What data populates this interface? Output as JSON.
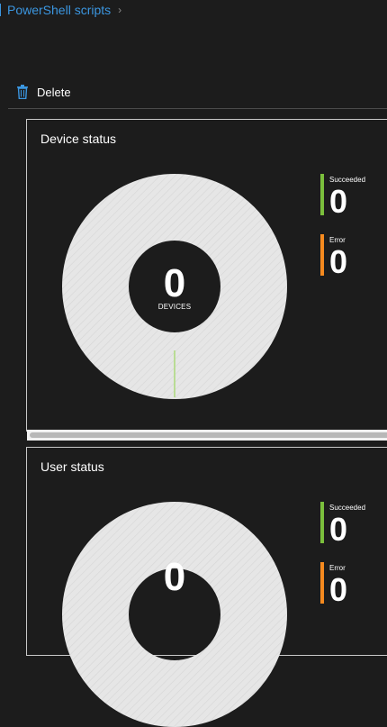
{
  "breadcrumb": {
    "label": "PowerShell scripts"
  },
  "toolbar": {
    "delete_label": "Delete"
  },
  "colors": {
    "accent": "#3b96e0",
    "succeeded": "#7bbf3c",
    "error": "#f58a1f",
    "donut": "#e6e6e6"
  },
  "device_status": {
    "title": "Device status",
    "total": "0",
    "total_label": "DEVICES",
    "legend": [
      {
        "label": "Succeeded",
        "value": "0"
      },
      {
        "label": "Error",
        "value": "0"
      }
    ]
  },
  "user_status": {
    "title": "User status",
    "total": "0",
    "legend": [
      {
        "label": "Succeeded",
        "value": "0"
      },
      {
        "label": "Error",
        "value": "0"
      }
    ]
  }
}
